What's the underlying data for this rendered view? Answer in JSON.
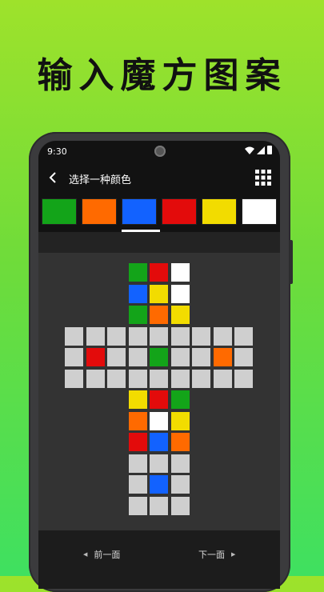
{
  "promo": {
    "title": "输入魔方图案"
  },
  "status_bar": {
    "time": "9:30"
  },
  "app_bar": {
    "title": "选择一种颜色"
  },
  "colors": {
    "G": "#13a419",
    "O": "#ff6a00",
    "B": "#1262ff",
    "R": "#e30b0b",
    "Y": "#f2dc00",
    "W": "#ffffff",
    "X": "#cfcfcf"
  },
  "palette": {
    "selected_index": 2,
    "swatches": [
      "G",
      "O",
      "B",
      "R",
      "Y",
      "W"
    ]
  },
  "cube": {
    "up": [
      "G",
      "R",
      "W",
      "B",
      "Y",
      "W",
      "G",
      "O",
      "Y"
    ],
    "left": [
      "X",
      "X",
      "X",
      "X",
      "R",
      "X",
      "X",
      "X",
      "X"
    ],
    "front": [
      "X",
      "X",
      "X",
      "X",
      "G",
      "X",
      "X",
      "X",
      "X"
    ],
    "right": [
      "X",
      "X",
      "X",
      "X",
      "O",
      "X",
      "X",
      "X",
      "X"
    ],
    "back": [
      "X",
      "X",
      "X",
      "X",
      "X",
      "X",
      "X",
      "X",
      "X"
    ],
    "down": [
      "Y",
      "R",
      "G",
      "O",
      "W",
      "Y",
      "R",
      "B",
      "O"
    ],
    "extra_face": [
      "X",
      "X",
      "X",
      "X",
      "B",
      "X",
      "X",
      "X",
      "X"
    ]
  },
  "bottom_nav": {
    "prev_label": "前一面",
    "next_label": "下一面"
  }
}
